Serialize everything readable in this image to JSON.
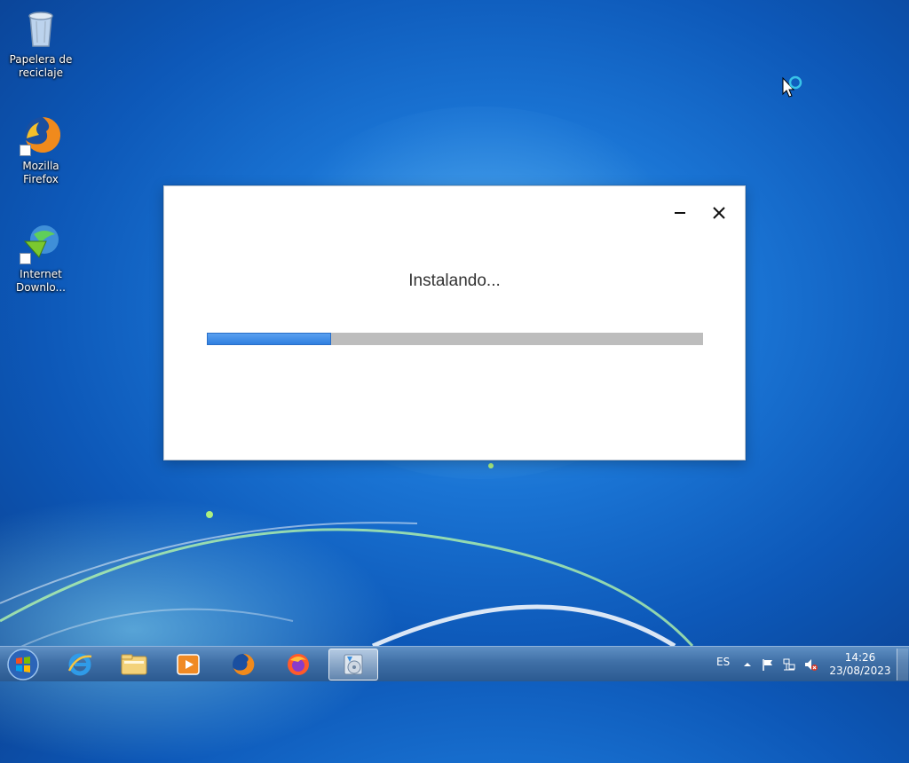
{
  "desktop": {
    "icons": [
      {
        "label": "Papelera de reciclaje"
      },
      {
        "label": "Mozilla Firefox"
      },
      {
        "label": "Internet Downlo..."
      }
    ]
  },
  "dialog": {
    "title": "Instalando...",
    "progress_fraction": 0.25
  },
  "taskbar": {
    "language": "ES",
    "time": "14:26",
    "date": "23/08/2023"
  }
}
